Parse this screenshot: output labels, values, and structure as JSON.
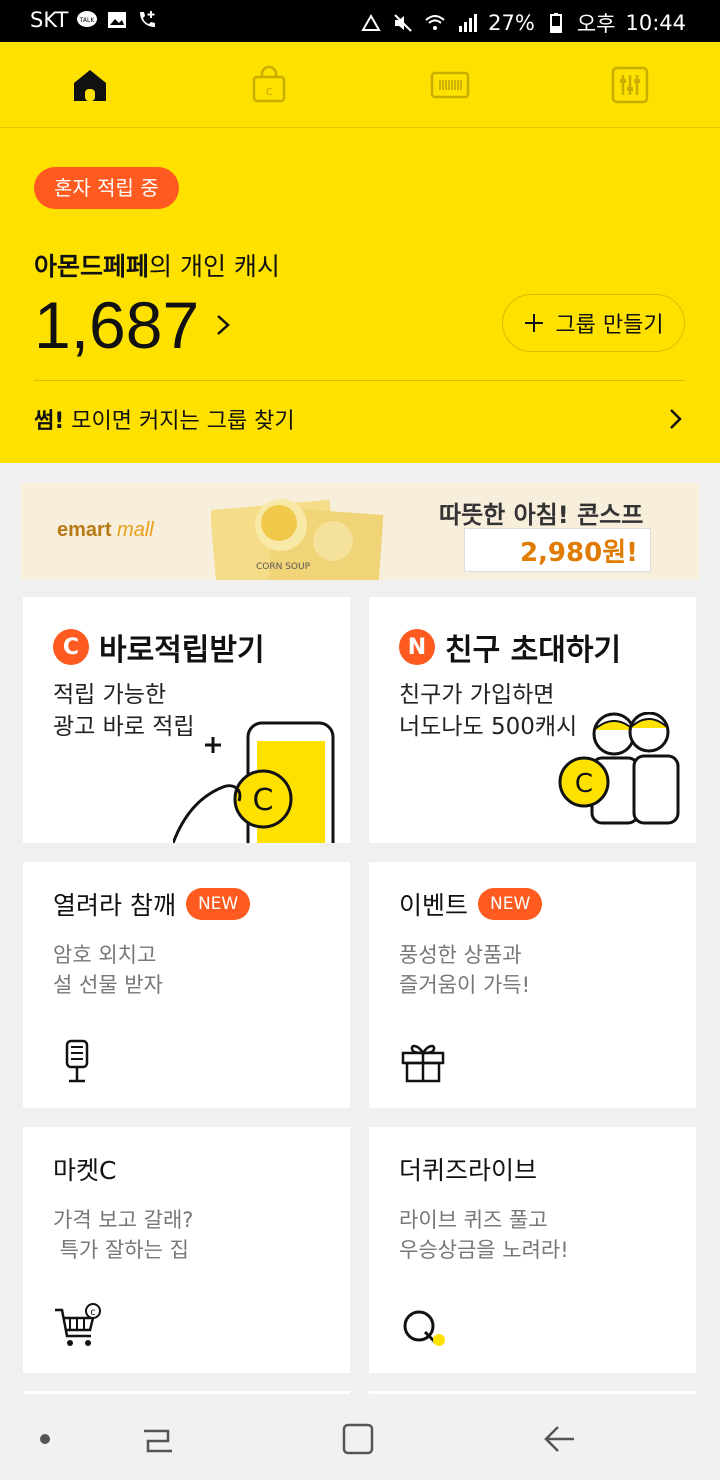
{
  "status_bar": {
    "carrier": "SKT",
    "talk_badge": "TALK",
    "battery": "27%",
    "ampm": "오후",
    "time": "10:44"
  },
  "nav": {
    "tabs": [
      {
        "icon": "home-icon",
        "active": true
      },
      {
        "icon": "shopping-bag-icon",
        "active": false
      },
      {
        "icon": "barcode-icon",
        "active": false
      },
      {
        "icon": "settings-sliders-icon",
        "active": false
      }
    ]
  },
  "wallet": {
    "badge": "혼자 적립 중",
    "owner_name": "아몬드페페",
    "owner_suffix": "의 개인 캐시",
    "balance": "1,687",
    "group_button": "그룹 만들기",
    "find_bold": "썸!",
    "find_text": " 모이면 커지는 그룹 찾기"
  },
  "ad": {
    "logo_main": "emart",
    "logo_sub": "mall",
    "product_label": "CORN SOUP",
    "headline": "따뜻한 아침! 콘스프",
    "price": "2,980원!"
  },
  "cards": {
    "instant": {
      "badge": "C",
      "title": "바로적립받기",
      "desc1": "적립 가능한",
      "desc2": "광고 바로 적립"
    },
    "invite": {
      "badge": "N",
      "title": "친구 초대하기",
      "desc1": "친구가 가입하면",
      "desc2": "너도나도 500캐시"
    },
    "sesame": {
      "title": "열려라 참깨",
      "new": "NEW",
      "desc1": "암호 외치고",
      "desc2": "설 선물 받자"
    },
    "event": {
      "title": "이벤트",
      "new": "NEW",
      "desc1": "풍성한 상품과",
      "desc2": "즐거움이 가득!"
    },
    "market": {
      "title": "마켓C",
      "desc1": "가격 보고 갈래?",
      "desc2": " 특가 잘하는 집"
    },
    "quiz": {
      "title": "더퀴즈라이브",
      "desc1": "라이브 퀴즈 풀고",
      "desc2": "우승상금을 노려라!"
    }
  },
  "colors": {
    "brand_yellow": "#ffe100",
    "accent_orange": "#ff5a1f"
  }
}
